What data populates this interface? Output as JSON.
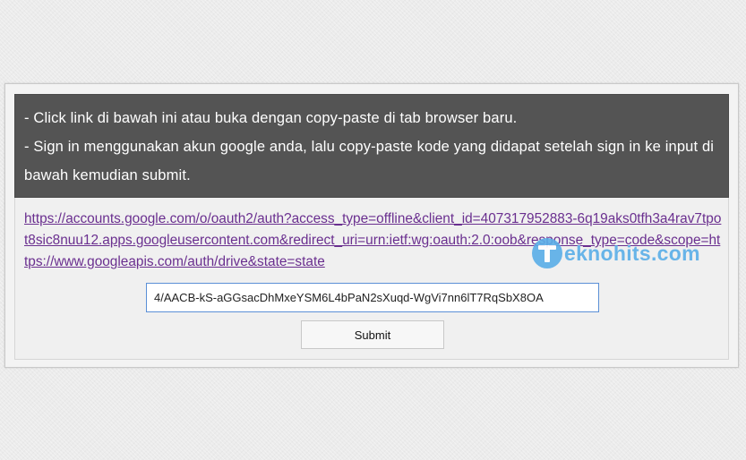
{
  "instructions": {
    "line1": "- Click link di bawah ini atau buka dengan copy-paste di tab browser baru.",
    "line2": "- Sign in menggunakan akun google anda, lalu copy-paste kode yang didapat setelah sign in ke input di bawah kemudian submit."
  },
  "auth_link": {
    "text": "https://accounts.google.com/o/oauth2/auth?access_type=offline&client_id=407317952883-6q19aks0tfh3a4rav7tpot8sic8nuu12.apps.googleusercontent.com&redirect_uri=urn:ietf:wg:oauth:2.0:oob&response_type=code&scope=https://www.googleapis.com/auth/drive&state=state"
  },
  "code_input": {
    "value": "4/AACB-kS-aGGsacDhMxeYSM6L4bPaN2sXuqd-WgVi7nn6lT7RqSbX8OA"
  },
  "submit": {
    "label": "Submit"
  },
  "watermark": {
    "text": "eknohits.com",
    "icon": "teknohits-logo-icon",
    "color": "#5aaee8"
  },
  "colors": {
    "notice_bg": "#545454",
    "link": "#6a2f8f",
    "input_border": "#5b8fd6"
  }
}
